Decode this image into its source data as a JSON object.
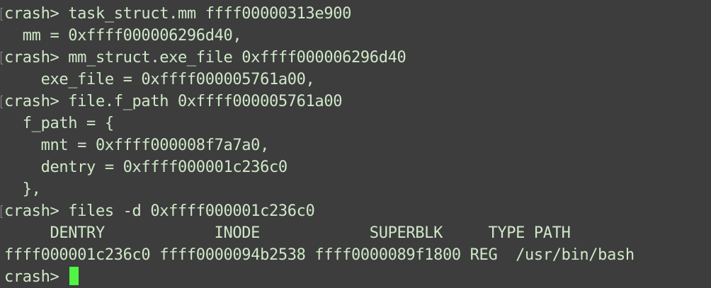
{
  "terminal": {
    "lines": [
      {
        "text": "crash> task_struct.mm ffff00000313e900",
        "prompt": true
      },
      {
        "text": "  mm = 0xffff000006296d40,",
        "prompt": false
      },
      {
        "text": "crash> mm_struct.exe_file 0xffff000006296d40",
        "prompt": true
      },
      {
        "text": "    exe_file = 0xffff000005761a00,",
        "prompt": false
      },
      {
        "text": "crash> file.f_path 0xffff000005761a00",
        "prompt": true
      },
      {
        "text": "  f_path = {",
        "prompt": false
      },
      {
        "text": "    mnt = 0xffff000008f7a7a0,",
        "prompt": false
      },
      {
        "text": "    dentry = 0xffff000001c236c0",
        "prompt": false
      },
      {
        "text": "  },",
        "prompt": false
      },
      {
        "text": "crash> files -d 0xffff000001c236c0",
        "prompt": true
      },
      {
        "text": "     DENTRY            INODE            SUPERBLK     TYPE PATH",
        "prompt": false
      },
      {
        "text": "ffff000001c236c0 ffff0000094b2538 ffff0000089f1800 REG  /usr/bin/bash",
        "prompt": false
      }
    ],
    "current_prompt": "crash> ",
    "cursor_color": "#4ff542",
    "text_color": "#cfe8c8",
    "background_color": "#3d3d3d"
  }
}
